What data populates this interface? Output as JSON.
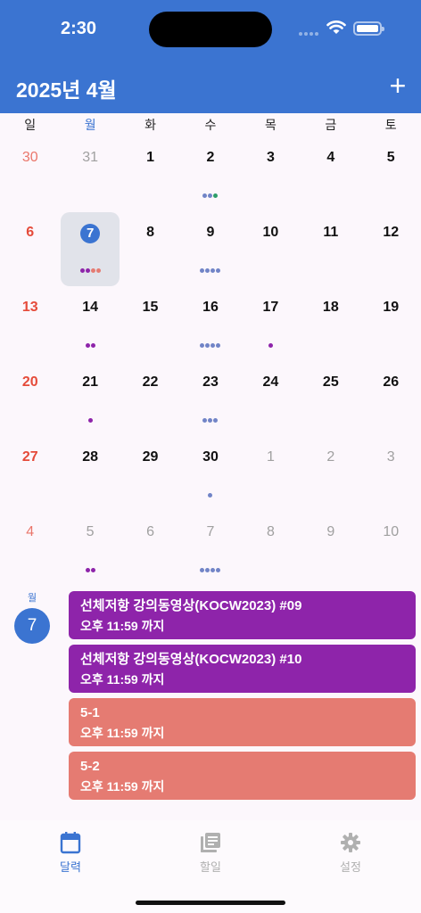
{
  "status": {
    "time": "2:30"
  },
  "header": {
    "title": "2025년 4월",
    "add_label": "+"
  },
  "weekdays": [
    "일",
    "월",
    "화",
    "수",
    "목",
    "금",
    "토"
  ],
  "colors": {
    "accent": "#3b74d1",
    "purple": "#8e24aa",
    "salmon": "#e57b72",
    "dot_blue": "#7184c7",
    "dot_green": "#2e9e6a",
    "sunday": "#e54b3a"
  },
  "weeks": [
    [
      {
        "d": "30",
        "m": true,
        "sun": true
      },
      {
        "d": "31",
        "m": true
      },
      {
        "d": "1"
      },
      {
        "d": "2",
        "dots": [
          "blue",
          "blue",
          "green"
        ]
      },
      {
        "d": "3"
      },
      {
        "d": "4"
      },
      {
        "d": "5"
      }
    ],
    [
      {
        "d": "6",
        "sun": true
      },
      {
        "d": "7",
        "sel": true,
        "dots": [
          "purple",
          "purple",
          "salmon",
          "salmon"
        ]
      },
      {
        "d": "8"
      },
      {
        "d": "9",
        "dots": [
          "blue",
          "blue",
          "blue",
          "blue"
        ]
      },
      {
        "d": "10"
      },
      {
        "d": "11"
      },
      {
        "d": "12"
      }
    ],
    [
      {
        "d": "13",
        "sun": true
      },
      {
        "d": "14",
        "dots": [
          "purple",
          "purple"
        ]
      },
      {
        "d": "15"
      },
      {
        "d": "16",
        "dots": [
          "blue",
          "blue",
          "blue",
          "blue"
        ]
      },
      {
        "d": "17",
        "dots": [
          "purple"
        ]
      },
      {
        "d": "18"
      },
      {
        "d": "19"
      }
    ],
    [
      {
        "d": "20",
        "sun": true
      },
      {
        "d": "21",
        "dots": [
          "purple"
        ]
      },
      {
        "d": "22"
      },
      {
        "d": "23",
        "dots": [
          "blue",
          "blue",
          "blue"
        ]
      },
      {
        "d": "24"
      },
      {
        "d": "25"
      },
      {
        "d": "26"
      }
    ],
    [
      {
        "d": "27",
        "sun": true
      },
      {
        "d": "28"
      },
      {
        "d": "29"
      },
      {
        "d": "30",
        "dots": [
          "blue"
        ]
      },
      {
        "d": "1",
        "m": true
      },
      {
        "d": "2",
        "m": true
      },
      {
        "d": "3",
        "m": true
      }
    ],
    [
      {
        "d": "4",
        "m": true,
        "sun": true
      },
      {
        "d": "5",
        "m": true,
        "dots": [
          "purple",
          "purple"
        ]
      },
      {
        "d": "6",
        "m": true
      },
      {
        "d": "7",
        "m": true,
        "dots": [
          "blue",
          "blue",
          "blue",
          "blue"
        ]
      },
      {
        "d": "8",
        "m": true
      },
      {
        "d": "9",
        "m": true
      },
      {
        "d": "10",
        "m": true
      }
    ]
  ],
  "selected_day": {
    "weekday": "월",
    "day": "7"
  },
  "events": [
    {
      "title": "선체저항 강의동영상(KOCW2023) #09",
      "time": "오후 11:59 까지",
      "color": "purple"
    },
    {
      "title": "선체저항 강의동영상(KOCW2023) #10",
      "time": "오후 11:59 까지",
      "color": "purple"
    },
    {
      "title": "5-1",
      "time": "오후 11:59 까지",
      "color": "salmon"
    },
    {
      "title": "5-2",
      "time": "오후 11:59 까지",
      "color": "salmon"
    }
  ],
  "tabs": [
    {
      "label": "달력",
      "icon": "calendar-icon",
      "active": true
    },
    {
      "label": "할일",
      "icon": "list-icon",
      "active": false
    },
    {
      "label": "설정",
      "icon": "gear-icon",
      "active": false
    }
  ]
}
